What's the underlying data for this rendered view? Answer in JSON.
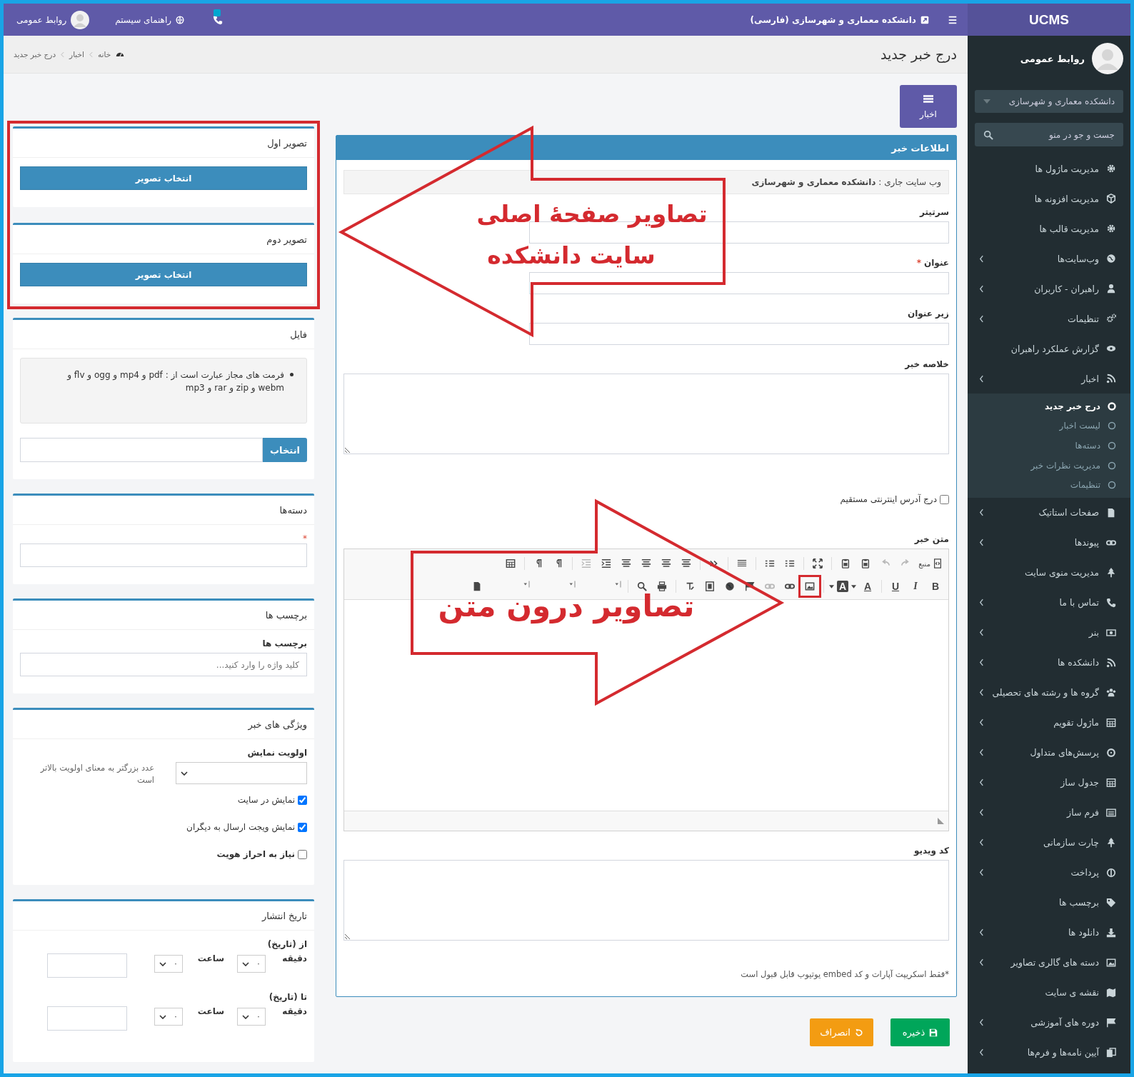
{
  "topbar": {
    "brand": "UCMS",
    "site_link": "دانشکده معماری و شهرسازی (فارسی)",
    "help_link": "راهنمای سیستم",
    "user_name": "روابط عمومی"
  },
  "sidebar": {
    "user_name": "روابط عمومی",
    "site_select": "دانشکده معماری و شهرسازی",
    "search_placeholder": "جست و جو در منو",
    "items": [
      {
        "label": "مدیریت ماژول ها",
        "has_submenu": false
      },
      {
        "label": "مدیریت افزونه ها",
        "has_submenu": false
      },
      {
        "label": "مدیریت قالب ها",
        "has_submenu": false
      },
      {
        "label": "وب‌سایت‌ها",
        "has_submenu": true
      },
      {
        "label": "راهبران - کاربران",
        "has_submenu": true
      },
      {
        "label": "تنظیمات",
        "has_submenu": true
      },
      {
        "label": "گزارش عملکرد راهبران",
        "has_submenu": false
      },
      {
        "label": "اخبار",
        "has_submenu": true,
        "expanded": true,
        "children": [
          {
            "label": "درج خبر جدید",
            "selected": true
          },
          {
            "label": "لیست اخبار",
            "selected": false
          },
          {
            "label": "دسته‌ها",
            "selected": false
          },
          {
            "label": "مدیریت نظرات خبر",
            "selected": false
          },
          {
            "label": "تنظیمات",
            "selected": false
          }
        ]
      },
      {
        "label": "صفحات استاتیک",
        "has_submenu": true
      },
      {
        "label": "پیوندها",
        "has_submenu": true
      },
      {
        "label": "مدیریت منوی سایت",
        "has_submenu": false
      },
      {
        "label": "تماس با ما",
        "has_submenu": true
      },
      {
        "label": "بنر",
        "has_submenu": true
      },
      {
        "label": "دانشکده ها",
        "has_submenu": true
      },
      {
        "label": "گروه ها و رشته های تحصیلی",
        "has_submenu": true
      },
      {
        "label": "ماژول تقویم",
        "has_submenu": true
      },
      {
        "label": "پرسش‌های متداول",
        "has_submenu": true
      },
      {
        "label": "جدول ساز",
        "has_submenu": true
      },
      {
        "label": "فرم ساز",
        "has_submenu": true
      },
      {
        "label": "چارت سازمانی",
        "has_submenu": true
      },
      {
        "label": "پرداخت",
        "has_submenu": true
      },
      {
        "label": "برچسب ها",
        "has_submenu": false
      },
      {
        "label": "دانلود ها",
        "has_submenu": true
      },
      {
        "label": "دسته های گالری تصاویر",
        "has_submenu": true
      },
      {
        "label": "نقشه ی سایت",
        "has_submenu": false
      },
      {
        "label": "دوره های آموزشی",
        "has_submenu": true
      },
      {
        "label": "آیین نامه‌ها و فرم‌ها",
        "has_submenu": true
      }
    ]
  },
  "header": {
    "title": "درج خبر جدید",
    "breadcrumb": [
      "خانه",
      "اخبار",
      "درج خبر جدید"
    ]
  },
  "news_button": "اخبار",
  "news_card": {
    "title": "اطلاعات خبر",
    "current_site": "وب سایت جاری : **دانشکده معماری و شهرسازی**",
    "fields": [
      {
        "label": "سرتیتر",
        "kind": "input"
      },
      {
        "label": "عنوان",
        "kind": "input",
        "required_mark": "*"
      },
      {
        "label": "زیر عنوان",
        "kind": "input"
      },
      {
        "label": "خلاصه خبر",
        "kind": "textarea"
      }
    ],
    "direct_link": {
      "label": "درج آدرس اینترنتی مستقیم",
      "checked": false
    },
    "editor": {
      "label": "متن خبر",
      "source_label": "منبع",
      "format_labels": [
        "B",
        "I",
        "U"
      ],
      "color_labels": [
        "A",
        "A"
      ]
    },
    "video": {
      "label": "کد ویدیو",
      "note": "*فقط اسکریپت آپارات و کد embed یوتیوب قابل قبول است"
    }
  },
  "actions": [
    {
      "label": "ذخیره",
      "kind": "save"
    },
    {
      "label": "انصراف",
      "kind": "cancel"
    }
  ],
  "image_cards": [
    {
      "title": "تصویر اول",
      "button": "انتخاب تصویر"
    },
    {
      "title": "تصویر دوم",
      "button": "انتخاب تصویر"
    }
  ],
  "file_card": {
    "title": "فایل",
    "formats": "فرمت های مجاز عبارت است از : pdf و mp4 و ogg و flv و webm و zip و rar و mp3",
    "button": "انتخاب"
  },
  "categories_card": {
    "title": "دسته‌ها",
    "required_mark": "*"
  },
  "tags_card": {
    "title": "برچسب ها",
    "label": "برچسب ها",
    "placeholder": "کلید واژه را وارد کنید..."
  },
  "properties_card": {
    "title": "ویژگی های خبر",
    "priority_label": "اولویت نمایش",
    "priority_help": "عدد بزرگتر به معنای اولویت بالاتر است",
    "options": [
      {
        "label": "نمایش در سایت",
        "checked": true,
        "bold": false
      },
      {
        "label": "نمایش ویجت ارسال به دیگران",
        "checked": true,
        "bold": false
      },
      {
        "label": "نیاز به احراز هویت",
        "checked": false,
        "bold": true
      }
    ]
  },
  "publish_card": {
    "title": "تاریخ انتشار",
    "ranges": [
      {
        "label": "از (تاریخ)",
        "minute_label": "دقیقه",
        "minute": "۰",
        "hour_label": "ساعت",
        "hour": "۰"
      },
      {
        "label": "تا (تاریخ)",
        "minute_label": "دقیقه",
        "minute": "۰",
        "hour_label": "ساعت",
        "hour": "۰"
      }
    ]
  },
  "annotations": {
    "left_frame": true,
    "image_tool_frame": true,
    "arrows": [
      {
        "kind": "left",
        "lines": [
          "تصاویر صفحهٔ اصلی",
          "سایت دانشکده"
        ]
      },
      {
        "kind": "right",
        "lines": [
          "تصاویر درون متن"
        ]
      }
    ]
  }
}
